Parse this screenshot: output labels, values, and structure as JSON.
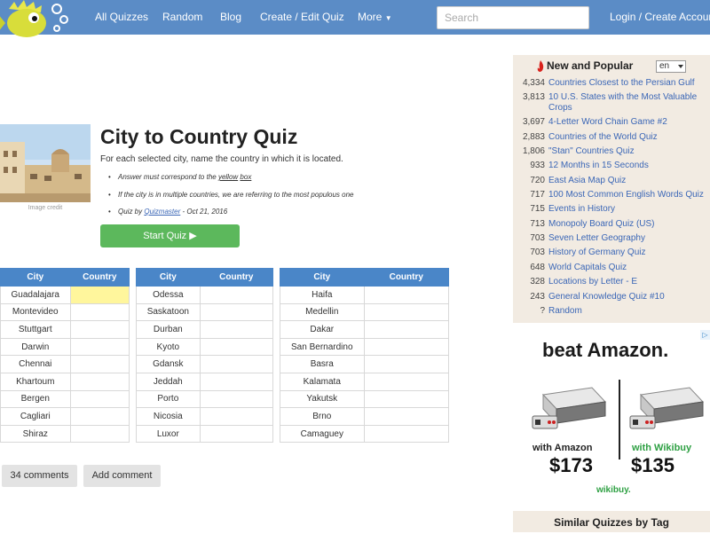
{
  "nav": {
    "links": [
      "All Quizzes",
      "Random",
      "Blog",
      "Create / Edit Quiz",
      "More",
      "Login / Create Account"
    ],
    "search_placeholder": "Search"
  },
  "quiz": {
    "image_credit": "Image credit",
    "title": "City to Country Quiz",
    "description": "For each selected city, name the country in which it is located.",
    "rule1_a": "Answer must correspond to the ",
    "rule1_b": "yellow",
    "rule1_c": " ",
    "rule1_d": "box",
    "rule2": "If the city is in multiple countries, we are referring to the most populous one",
    "byline_prefix": "Quiz by ",
    "author": "Quizmaster",
    "byline_suffix": " - Oct 21, 2016",
    "start_label": "Start Quiz"
  },
  "table": {
    "col_city": "City",
    "col_country": "Country",
    "groups": [
      [
        "Guadalajara",
        "Montevideo",
        "Stuttgart",
        "Darwin",
        "Chennai",
        "Khartoum",
        "Bergen",
        "Cagliari",
        "Shiraz"
      ],
      [
        "Odessa",
        "Saskatoon",
        "Durban",
        "Kyoto",
        "Gdansk",
        "Jeddah",
        "Porto",
        "Nicosia",
        "Luxor"
      ],
      [
        "Haifa",
        "Medellin",
        "Dakar",
        "San Bernardino",
        "Basra",
        "Kalamata",
        "Yakutsk",
        "Brno",
        "Camaguey"
      ]
    ]
  },
  "buttons": {
    "comments": "34 comments",
    "add_comment": "Add comment"
  },
  "new_popular": {
    "title": "New and Popular",
    "lang": "en",
    "items": [
      {
        "count": "4,334",
        "label": "Countries Closest to the Persian Gulf"
      },
      {
        "count": "3,813",
        "label": "10 U.S. States with the Most Valuable"
      },
      {
        "count": "",
        "label": "Crops"
      },
      {
        "count": "3,697",
        "label": "4-Letter Word Chain Game #2"
      },
      {
        "count": "2,883",
        "label": "Countries of the World Quiz"
      },
      {
        "count": "1,806",
        "label": "\"Stan\" Countries Quiz"
      },
      {
        "count": "933",
        "label": "12 Months in 15 Seconds"
      },
      {
        "count": "720",
        "label": "East Asia Map Quiz"
      },
      {
        "count": "717",
        "label": "100 Most Common English Words Quiz"
      },
      {
        "count": "715",
        "label": "Events in History"
      },
      {
        "count": "713",
        "label": "Monopoly Board Quiz (US)"
      },
      {
        "count": "703",
        "label": "Seven Letter Geography"
      },
      {
        "count": "703",
        "label": "History of Germany Quiz"
      },
      {
        "count": "648",
        "label": "World Capitals Quiz"
      },
      {
        "count": "328",
        "label": "Locations by Letter - E"
      },
      {
        "count": "243",
        "label": "General Knowledge Quiz #10"
      },
      {
        "count": "?",
        "label": "Random"
      }
    ]
  },
  "ad": {
    "headline": "beat Amazon.",
    "left_label": "with Amazon",
    "left_price": "$173",
    "right_label": "with Wikibuy",
    "right_price": "$135",
    "brand": "wikibuy."
  },
  "similar": {
    "title": "Similar Quizzes by Tag"
  },
  "colors": {
    "navbar": "#5b8cc6",
    "table_header": "#4a86c8",
    "start_button": "#5cb85c",
    "highlight": "#fff69c",
    "sidebar_bg": "#f2ebe2",
    "link": "#3a66b6"
  }
}
